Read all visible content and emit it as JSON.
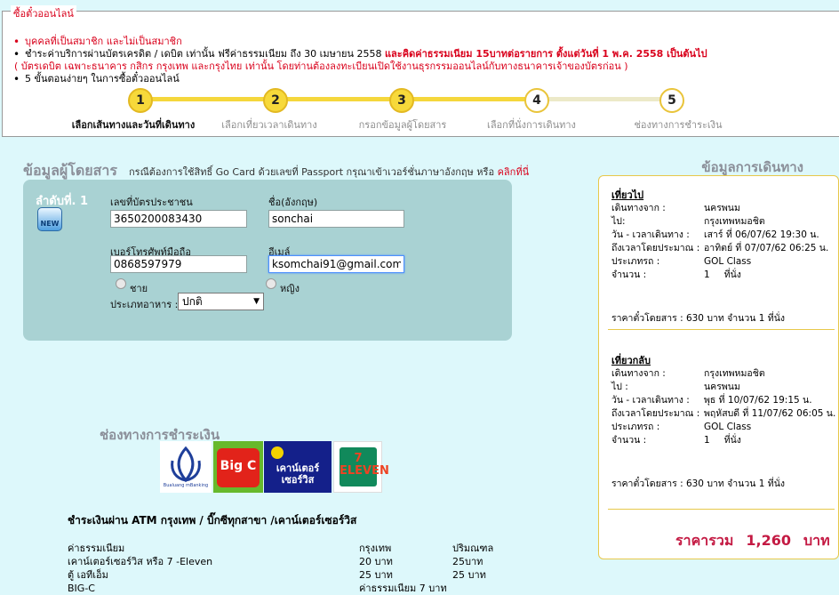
{
  "colors": {
    "accent_red": "#d9001b",
    "step_yellow": "#f7d93a",
    "card_bg": "#a9d2d3",
    "page_bg": "#ddf8fb",
    "panel_border": "#e7c84a",
    "total_red": "#c41a43"
  },
  "info": {
    "legend": "ซื้อตั๋วออนไลน์",
    "line1": "บุคคลที่เป็นสมาชิก และไม่เป็นสมาชิก",
    "line2a": "ชำระค่าบริการผ่านบัตรเครดิต / เดบิต เท่านั้น ฟรีค่าธรรมเนียม ถึง 30 เมษายน 2558",
    "line2b": "และคิดค่าธรรมเนียม 15บาทต่อรายการ ตั้งแต่วันที่ 1 พ.ค. 2558 เป็นต้นไป",
    "line3": "( บัตรเดบิต เฉพาะธนาคาร กสิกร กรุงเทพ และกรุงไทย เท่านั้น โดยท่านต้องลงทะเบียนเปิดใช้งานธุรกรรมออนไลน์กับทางธนาคารเจ้าของบัตรก่อน )",
    "line4": "5 ขั้นตอนง่ายๆ ในการซื้อตั๋วออนไลน์"
  },
  "steps": [
    {
      "num": "1",
      "label": "เลือกเส้นทางและวันที่เดินทาง",
      "state": "active"
    },
    {
      "num": "2",
      "label": "เลือกเที่ยวเวลาเดินทาง",
      "state": "done"
    },
    {
      "num": "3",
      "label": "กรอกข้อมูลผู้โดยสาร",
      "state": "done"
    },
    {
      "num": "4",
      "label": "เลือกที่นั่งการเดินทาง",
      "state": "inactive"
    },
    {
      "num": "5",
      "label": "ช่องทางการชำระเงิน",
      "state": "inactive"
    }
  ],
  "passenger": {
    "title": "ข้อมูลผู้โดยสาร",
    "desc": "กรณีต้องการใช้สิทธิ์ Go Card ด้วยเลขที่ Passport กรุณาเข้าเวอร์ชั่นภาษาอังกฤษ หรือ",
    "desc_link": "คลิกที่นี่",
    "seat_label": "ลำดับที่. 1",
    "new_icon_text": "NEW",
    "id_label": "เลขที่บัตรประชาชน",
    "id_value": "3650200083430",
    "name_label": "ชื่อ(อังกฤษ)",
    "name_value": "sonchai",
    "phone_label": "เบอร์โทรศัพท์มือถือ",
    "phone_value": "0868597979",
    "email_label": "อีเมล์",
    "email_value": "ksomchai91@gmail.com",
    "male_label": "ชาย",
    "female_label": "หญิง",
    "food_label": "ประเภทอาหาร :",
    "food_value": "ปกติ"
  },
  "payment": {
    "title": "ช่องทางการชำระเงิน",
    "bbl_text": "Bualuang mBanking",
    "bigc_text": "Big C",
    "cs_text": "เคาน์เตอร์ เซอร์วิส",
    "seven_text": "7 ELEVEN",
    "atm_title": "ชำระเงินผ่าน ATM กรุงเทพ / บิ๊กซีทุกสาขา /เคาน์เตอร์เซอร์วิส",
    "fee_rows": [
      [
        "ค่าธรรมเนียม",
        "กรุงเทพ",
        "ปริมณฑล"
      ],
      [
        "เคาน์เตอร์เซอร์วิส หรือ 7 -Eleven",
        "20 บาท",
        "25บาท"
      ],
      [
        "ตู้ เอทีเอ็ม",
        "25 บาท",
        "25 บาท"
      ],
      [
        "BIG-C",
        "ค่าธรรมเนียม 7 บาท",
        ""
      ]
    ]
  },
  "trip": {
    "title": "ข้อมูลการเดินทาง",
    "outbound": {
      "head": "เที่ยวไป",
      "rows": [
        [
          "เดินทางจาก :",
          "นครพนม"
        ],
        [
          "ไป:",
          "กรุงเทพหมอชิต"
        ],
        [
          "วัน - เวลาเดินทาง :",
          "เสาร์ ที่ 06/07/62 19:30 น."
        ],
        [
          "ถึงเวลาโดยประมาณ :",
          "อาทิตย์ ที่ 07/07/62 06:25 น."
        ],
        [
          "ประเภทรถ :",
          "GOL Class"
        ]
      ],
      "count_label": "จำนวน :",
      "count_value": "1",
      "count_unit": "ที่นั่ง",
      "price": "ราคาตั๋วโดยสาร : 630  บาท   จำนวน 1 ที่นั่ง"
    },
    "return": {
      "head": "เที่ยวกลับ",
      "rows": [
        [
          "เดินทางจาก :",
          "กรุงเทพหมอชิต"
        ],
        [
          "ไป :",
          "นครพนม"
        ],
        [
          "วัน - เวลาเดินทาง :",
          "พุธ ที่ 10/07/62 19:15 น."
        ],
        [
          "ถึงเวลาโดยประมาณ :",
          "พฤหัสบดี ที่ 11/07/62 06:05 น."
        ],
        [
          "ประเภทรถ :",
          "GOL Class"
        ]
      ],
      "count_label": "จำนวน :",
      "count_value": "1",
      "count_unit": "ที่นั่ง",
      "price": "ราคาตั๋วโดยสาร : 630  บาท   จำนวน 1 ที่นั่ง"
    },
    "total_label": "ราคารวม",
    "total_amount": "1,260",
    "total_unit": "บาท"
  }
}
